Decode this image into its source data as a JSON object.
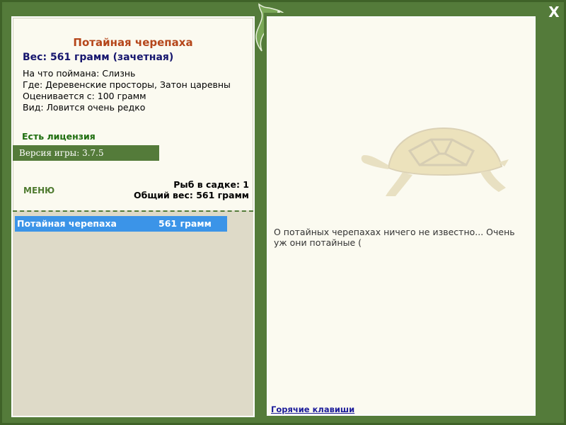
{
  "window": {
    "close_label": "X"
  },
  "fish": {
    "title": "Потайная черепаха",
    "weight": "Вес: 561 грамм (зачетная)",
    "caught_on": "На что поймана: Слизнь",
    "where": "Где: Деревенские просторы, Затон царевны",
    "rated_from": "Оценивается с: 100 грамм",
    "type": "Вид: Ловится очень редко"
  },
  "license": "Есть лицензия",
  "version": "Версия игры: 3.7.5",
  "menu_label": "МЕНЮ",
  "keepnet": {
    "count": "Рыб в садке: 1",
    "total": "Общий вес: 561 грамм"
  },
  "catch_list": [
    {
      "name": "Потайная черепаха",
      "weight": "561 грамм"
    }
  ],
  "description": "О потайных черепахах ничего не известно... Очень уж они потайные (",
  "hotkeys_label": "Горячие клавиши",
  "colors": {
    "frame": "#547b3a",
    "panel": "#fbfaf0",
    "title": "#b5461a",
    "selection": "#3b94e8"
  }
}
